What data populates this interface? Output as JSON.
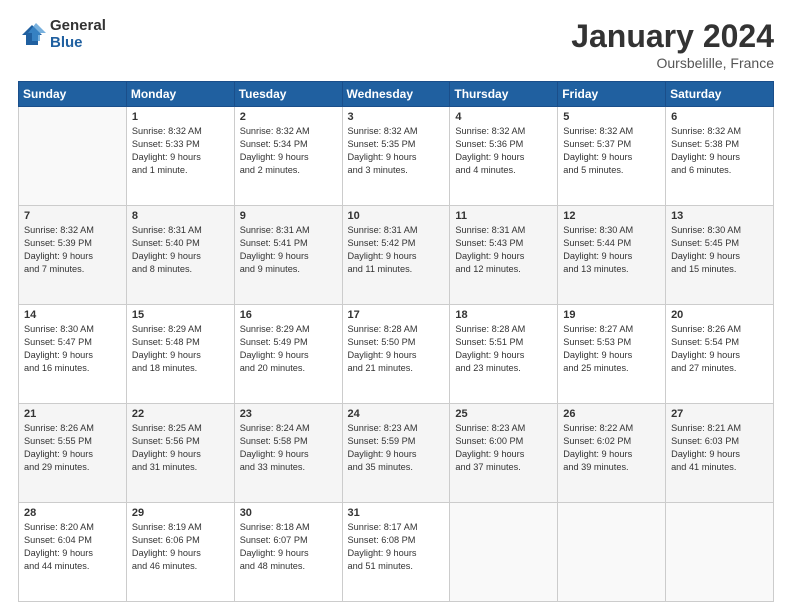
{
  "logo": {
    "general": "General",
    "blue": "Blue"
  },
  "header": {
    "month": "January 2024",
    "location": "Oursbelille, France"
  },
  "weekdays": [
    "Sunday",
    "Monday",
    "Tuesday",
    "Wednesday",
    "Thursday",
    "Friday",
    "Saturday"
  ],
  "weeks": [
    [
      {
        "day": "",
        "sunrise": "",
        "sunset": "",
        "daylight": ""
      },
      {
        "day": "1",
        "sunrise": "Sunrise: 8:32 AM",
        "sunset": "Sunset: 5:33 PM",
        "daylight": "Daylight: 9 hours and 1 minute."
      },
      {
        "day": "2",
        "sunrise": "Sunrise: 8:32 AM",
        "sunset": "Sunset: 5:34 PM",
        "daylight": "Daylight: 9 hours and 2 minutes."
      },
      {
        "day": "3",
        "sunrise": "Sunrise: 8:32 AM",
        "sunset": "Sunset: 5:35 PM",
        "daylight": "Daylight: 9 hours and 3 minutes."
      },
      {
        "day": "4",
        "sunrise": "Sunrise: 8:32 AM",
        "sunset": "Sunset: 5:36 PM",
        "daylight": "Daylight: 9 hours and 4 minutes."
      },
      {
        "day": "5",
        "sunrise": "Sunrise: 8:32 AM",
        "sunset": "Sunset: 5:37 PM",
        "daylight": "Daylight: 9 hours and 5 minutes."
      },
      {
        "day": "6",
        "sunrise": "Sunrise: 8:32 AM",
        "sunset": "Sunset: 5:38 PM",
        "daylight": "Daylight: 9 hours and 6 minutes."
      }
    ],
    [
      {
        "day": "7",
        "sunrise": "Sunrise: 8:32 AM",
        "sunset": "Sunset: 5:39 PM",
        "daylight": "Daylight: 9 hours and 7 minutes."
      },
      {
        "day": "8",
        "sunrise": "Sunrise: 8:31 AM",
        "sunset": "Sunset: 5:40 PM",
        "daylight": "Daylight: 9 hours and 8 minutes."
      },
      {
        "day": "9",
        "sunrise": "Sunrise: 8:31 AM",
        "sunset": "Sunset: 5:41 PM",
        "daylight": "Daylight: 9 hours and 9 minutes."
      },
      {
        "day": "10",
        "sunrise": "Sunrise: 8:31 AM",
        "sunset": "Sunset: 5:42 PM",
        "daylight": "Daylight: 9 hours and 11 minutes."
      },
      {
        "day": "11",
        "sunrise": "Sunrise: 8:31 AM",
        "sunset": "Sunset: 5:43 PM",
        "daylight": "Daylight: 9 hours and 12 minutes."
      },
      {
        "day": "12",
        "sunrise": "Sunrise: 8:30 AM",
        "sunset": "Sunset: 5:44 PM",
        "daylight": "Daylight: 9 hours and 13 minutes."
      },
      {
        "day": "13",
        "sunrise": "Sunrise: 8:30 AM",
        "sunset": "Sunset: 5:45 PM",
        "daylight": "Daylight: 9 hours and 15 minutes."
      }
    ],
    [
      {
        "day": "14",
        "sunrise": "Sunrise: 8:30 AM",
        "sunset": "Sunset: 5:47 PM",
        "daylight": "Daylight: 9 hours and 16 minutes."
      },
      {
        "day": "15",
        "sunrise": "Sunrise: 8:29 AM",
        "sunset": "Sunset: 5:48 PM",
        "daylight": "Daylight: 9 hours and 18 minutes."
      },
      {
        "day": "16",
        "sunrise": "Sunrise: 8:29 AM",
        "sunset": "Sunset: 5:49 PM",
        "daylight": "Daylight: 9 hours and 20 minutes."
      },
      {
        "day": "17",
        "sunrise": "Sunrise: 8:28 AM",
        "sunset": "Sunset: 5:50 PM",
        "daylight": "Daylight: 9 hours and 21 minutes."
      },
      {
        "day": "18",
        "sunrise": "Sunrise: 8:28 AM",
        "sunset": "Sunset: 5:51 PM",
        "daylight": "Daylight: 9 hours and 23 minutes."
      },
      {
        "day": "19",
        "sunrise": "Sunrise: 8:27 AM",
        "sunset": "Sunset: 5:53 PM",
        "daylight": "Daylight: 9 hours and 25 minutes."
      },
      {
        "day": "20",
        "sunrise": "Sunrise: 8:26 AM",
        "sunset": "Sunset: 5:54 PM",
        "daylight": "Daylight: 9 hours and 27 minutes."
      }
    ],
    [
      {
        "day": "21",
        "sunrise": "Sunrise: 8:26 AM",
        "sunset": "Sunset: 5:55 PM",
        "daylight": "Daylight: 9 hours and 29 minutes."
      },
      {
        "day": "22",
        "sunrise": "Sunrise: 8:25 AM",
        "sunset": "Sunset: 5:56 PM",
        "daylight": "Daylight: 9 hours and 31 minutes."
      },
      {
        "day": "23",
        "sunrise": "Sunrise: 8:24 AM",
        "sunset": "Sunset: 5:58 PM",
        "daylight": "Daylight: 9 hours and 33 minutes."
      },
      {
        "day": "24",
        "sunrise": "Sunrise: 8:23 AM",
        "sunset": "Sunset: 5:59 PM",
        "daylight": "Daylight: 9 hours and 35 minutes."
      },
      {
        "day": "25",
        "sunrise": "Sunrise: 8:23 AM",
        "sunset": "Sunset: 6:00 PM",
        "daylight": "Daylight: 9 hours and 37 minutes."
      },
      {
        "day": "26",
        "sunrise": "Sunrise: 8:22 AM",
        "sunset": "Sunset: 6:02 PM",
        "daylight": "Daylight: 9 hours and 39 minutes."
      },
      {
        "day": "27",
        "sunrise": "Sunrise: 8:21 AM",
        "sunset": "Sunset: 6:03 PM",
        "daylight": "Daylight: 9 hours and 41 minutes."
      }
    ],
    [
      {
        "day": "28",
        "sunrise": "Sunrise: 8:20 AM",
        "sunset": "Sunset: 6:04 PM",
        "daylight": "Daylight: 9 hours and 44 minutes."
      },
      {
        "day": "29",
        "sunrise": "Sunrise: 8:19 AM",
        "sunset": "Sunset: 6:06 PM",
        "daylight": "Daylight: 9 hours and 46 minutes."
      },
      {
        "day": "30",
        "sunrise": "Sunrise: 8:18 AM",
        "sunset": "Sunset: 6:07 PM",
        "daylight": "Daylight: 9 hours and 48 minutes."
      },
      {
        "day": "31",
        "sunrise": "Sunrise: 8:17 AM",
        "sunset": "Sunset: 6:08 PM",
        "daylight": "Daylight: 9 hours and 51 minutes."
      },
      {
        "day": "",
        "sunrise": "",
        "sunset": "",
        "daylight": ""
      },
      {
        "day": "",
        "sunrise": "",
        "sunset": "",
        "daylight": ""
      },
      {
        "day": "",
        "sunrise": "",
        "sunset": "",
        "daylight": ""
      }
    ]
  ]
}
